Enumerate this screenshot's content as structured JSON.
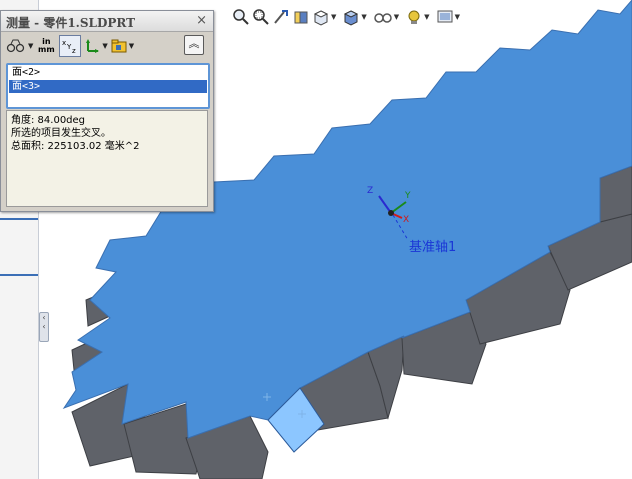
{
  "panel": {
    "title": "测量 - 零件1.SLDPRT",
    "close_glyph": "×",
    "toolbar": {
      "units_top": "in",
      "units_bottom": "mm",
      "collapse_glyph": "︽"
    },
    "selections": [
      "面<2>",
      "面<3>"
    ],
    "selected_index": 1,
    "results": [
      "角度: 84.00deg",
      "所选的项目发生交叉。",
      "总面积: 225103.02 毫米^2"
    ]
  },
  "viewport": {
    "axis_label": "基准轴1",
    "triad": {
      "x": "X",
      "y": "Y",
      "z": "Z"
    }
  },
  "hud_toolbar": {
    "icons": [
      "zoom-to-fit-icon",
      "zoom-area-icon",
      "previous-view-icon",
      "section-view-icon",
      "view-orientation-icon",
      "display-style-icon",
      "hide-show-icon",
      "edit-appearance-icon",
      "apply-scene-icon"
    ]
  },
  "colors": {
    "model_face": "#4a8fd8",
    "model_side": "#60646c",
    "selected_face": "#8cc6ff",
    "panel_bg": "#d4d0c8",
    "list_selected": "#316ac5",
    "axis_label": "#1a36d6"
  }
}
